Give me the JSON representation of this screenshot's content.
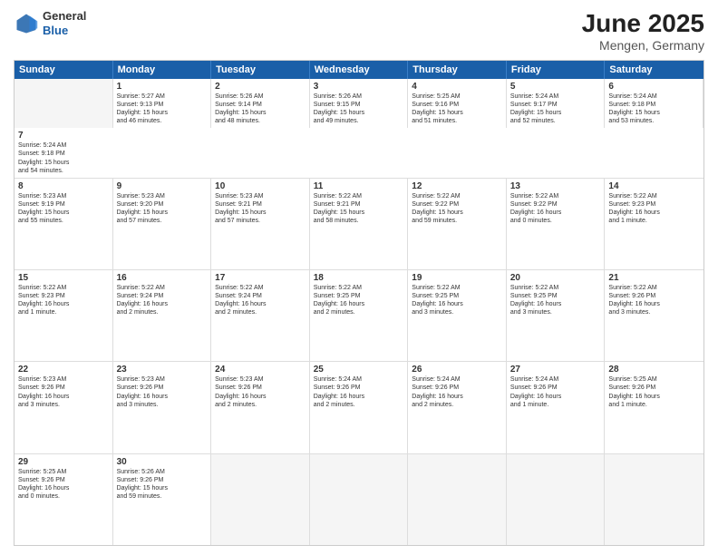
{
  "logo": {
    "general": "General",
    "blue": "Blue"
  },
  "title": "June 2025",
  "subtitle": "Mengen, Germany",
  "days": [
    "Sunday",
    "Monday",
    "Tuesday",
    "Wednesday",
    "Thursday",
    "Friday",
    "Saturday"
  ],
  "rows": [
    [
      {
        "num": "",
        "text": "",
        "empty": true
      },
      {
        "num": "1",
        "text": "Sunrise: 5:27 AM\nSunset: 9:13 PM\nDaylight: 15 hours\nand 46 minutes.",
        "empty": false
      },
      {
        "num": "2",
        "text": "Sunrise: 5:26 AM\nSunset: 9:14 PM\nDaylight: 15 hours\nand 48 minutes.",
        "empty": false
      },
      {
        "num": "3",
        "text": "Sunrise: 5:26 AM\nSunset: 9:15 PM\nDaylight: 15 hours\nand 49 minutes.",
        "empty": false
      },
      {
        "num": "4",
        "text": "Sunrise: 5:25 AM\nSunset: 9:16 PM\nDaylight: 15 hours\nand 51 minutes.",
        "empty": false
      },
      {
        "num": "5",
        "text": "Sunrise: 5:24 AM\nSunset: 9:17 PM\nDaylight: 15 hours\nand 52 minutes.",
        "empty": false
      },
      {
        "num": "6",
        "text": "Sunrise: 5:24 AM\nSunset: 9:18 PM\nDaylight: 15 hours\nand 53 minutes.",
        "empty": false
      },
      {
        "num": "7",
        "text": "Sunrise: 5:24 AM\nSunset: 9:18 PM\nDaylight: 15 hours\nand 54 minutes.",
        "empty": false
      }
    ],
    [
      {
        "num": "8",
        "text": "Sunrise: 5:23 AM\nSunset: 9:19 PM\nDaylight: 15 hours\nand 55 minutes.",
        "empty": false
      },
      {
        "num": "9",
        "text": "Sunrise: 5:23 AM\nSunset: 9:20 PM\nDaylight: 15 hours\nand 57 minutes.",
        "empty": false
      },
      {
        "num": "10",
        "text": "Sunrise: 5:23 AM\nSunset: 9:21 PM\nDaylight: 15 hours\nand 57 minutes.",
        "empty": false
      },
      {
        "num": "11",
        "text": "Sunrise: 5:22 AM\nSunset: 9:21 PM\nDaylight: 15 hours\nand 58 minutes.",
        "empty": false
      },
      {
        "num": "12",
        "text": "Sunrise: 5:22 AM\nSunset: 9:22 PM\nDaylight: 15 hours\nand 59 minutes.",
        "empty": false
      },
      {
        "num": "13",
        "text": "Sunrise: 5:22 AM\nSunset: 9:22 PM\nDaylight: 16 hours\nand 0 minutes.",
        "empty": false
      },
      {
        "num": "14",
        "text": "Sunrise: 5:22 AM\nSunset: 9:23 PM\nDaylight: 16 hours\nand 1 minute.",
        "empty": false
      }
    ],
    [
      {
        "num": "15",
        "text": "Sunrise: 5:22 AM\nSunset: 9:23 PM\nDaylight: 16 hours\nand 1 minute.",
        "empty": false
      },
      {
        "num": "16",
        "text": "Sunrise: 5:22 AM\nSunset: 9:24 PM\nDaylight: 16 hours\nand 2 minutes.",
        "empty": false
      },
      {
        "num": "17",
        "text": "Sunrise: 5:22 AM\nSunset: 9:24 PM\nDaylight: 16 hours\nand 2 minutes.",
        "empty": false
      },
      {
        "num": "18",
        "text": "Sunrise: 5:22 AM\nSunset: 9:25 PM\nDaylight: 16 hours\nand 2 minutes.",
        "empty": false
      },
      {
        "num": "19",
        "text": "Sunrise: 5:22 AM\nSunset: 9:25 PM\nDaylight: 16 hours\nand 3 minutes.",
        "empty": false
      },
      {
        "num": "20",
        "text": "Sunrise: 5:22 AM\nSunset: 9:25 PM\nDaylight: 16 hours\nand 3 minutes.",
        "empty": false
      },
      {
        "num": "21",
        "text": "Sunrise: 5:22 AM\nSunset: 9:26 PM\nDaylight: 16 hours\nand 3 minutes.",
        "empty": false
      }
    ],
    [
      {
        "num": "22",
        "text": "Sunrise: 5:23 AM\nSunset: 9:26 PM\nDaylight: 16 hours\nand 3 minutes.",
        "empty": false
      },
      {
        "num": "23",
        "text": "Sunrise: 5:23 AM\nSunset: 9:26 PM\nDaylight: 16 hours\nand 3 minutes.",
        "empty": false
      },
      {
        "num": "24",
        "text": "Sunrise: 5:23 AM\nSunset: 9:26 PM\nDaylight: 16 hours\nand 2 minutes.",
        "empty": false
      },
      {
        "num": "25",
        "text": "Sunrise: 5:24 AM\nSunset: 9:26 PM\nDaylight: 16 hours\nand 2 minutes.",
        "empty": false
      },
      {
        "num": "26",
        "text": "Sunrise: 5:24 AM\nSunset: 9:26 PM\nDaylight: 16 hours\nand 2 minutes.",
        "empty": false
      },
      {
        "num": "27",
        "text": "Sunrise: 5:24 AM\nSunset: 9:26 PM\nDaylight: 16 hours\nand 1 minute.",
        "empty": false
      },
      {
        "num": "28",
        "text": "Sunrise: 5:25 AM\nSunset: 9:26 PM\nDaylight: 16 hours\nand 1 minute.",
        "empty": false
      }
    ],
    [
      {
        "num": "29",
        "text": "Sunrise: 5:25 AM\nSunset: 9:26 PM\nDaylight: 16 hours\nand 0 minutes.",
        "empty": false
      },
      {
        "num": "30",
        "text": "Sunrise: 5:26 AM\nSunset: 9:26 PM\nDaylight: 15 hours\nand 59 minutes.",
        "empty": false
      },
      {
        "num": "",
        "text": "",
        "empty": true
      },
      {
        "num": "",
        "text": "",
        "empty": true
      },
      {
        "num": "",
        "text": "",
        "empty": true
      },
      {
        "num": "",
        "text": "",
        "empty": true
      },
      {
        "num": "",
        "text": "",
        "empty": true
      }
    ]
  ]
}
